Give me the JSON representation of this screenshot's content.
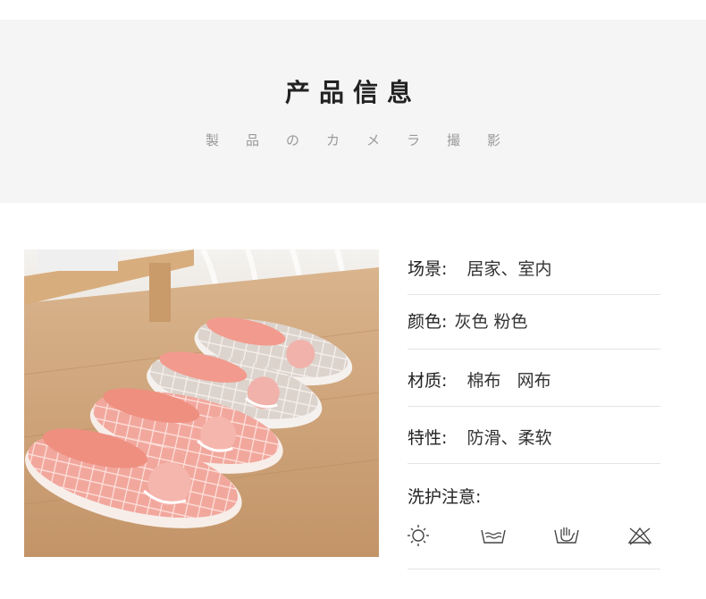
{
  "header": {
    "title": "产品信息",
    "subtitle": "製品のカメラ撮影"
  },
  "info": {
    "rows": [
      {
        "label": "场景:",
        "value": "居家、室内"
      },
      {
        "label": "颜色:",
        "value": "灰色 粉色"
      },
      {
        "label": "材质:",
        "value": "棉布   网布"
      },
      {
        "label": "特性:",
        "value": "防滑、柔软"
      }
    ],
    "care_title": "洗护注意:",
    "care_icons": [
      "sun-dry-icon",
      "water-wash-icon",
      "hand-wash-icon",
      "no-bleach-icon"
    ]
  },
  "colors": {
    "header_bg": "#f5f5f5",
    "divider": "#e4e4e4",
    "slipper_pink": "#f0a9a0",
    "slipper_grey": "#d9cfc8",
    "floor": "#c9a17a"
  }
}
